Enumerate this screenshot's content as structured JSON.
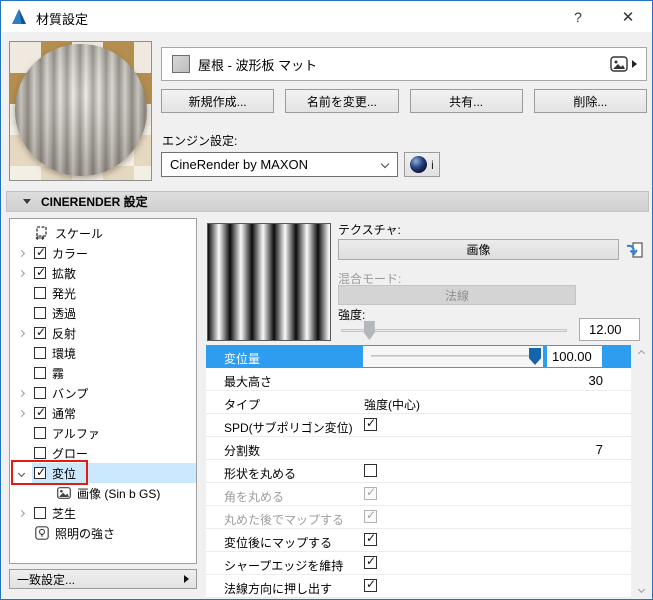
{
  "title_bar": {
    "title": "材質設定",
    "help_label": "?",
    "close_label": "✕"
  },
  "material_header": {
    "name": "屋根 - 波形板 マット"
  },
  "action_buttons": [
    {
      "label": "新規作成..."
    },
    {
      "label": "名前を変更..."
    },
    {
      "label": "共有..."
    },
    {
      "label": "削除..."
    }
  ],
  "engine": {
    "label": "エンジン設定:",
    "selected": "CineRender by MAXON",
    "info_label": "i"
  },
  "section_header": {
    "title": "CINERENDER 設定"
  },
  "channel_tree": {
    "items": [
      {
        "label": "スケール",
        "icon": "scale-icon"
      },
      {
        "label": "カラー",
        "expand": "collapsed",
        "checked": true
      },
      {
        "label": "拡散",
        "expand": "collapsed",
        "checked": true
      },
      {
        "label": "発光",
        "checked": false
      },
      {
        "label": "透過",
        "checked": false
      },
      {
        "label": "反射",
        "expand": "collapsed",
        "checked": true
      },
      {
        "label": "環境",
        "checked": false
      },
      {
        "label": "霧",
        "checked": false
      },
      {
        "label": "バンプ",
        "expand": "collapsed",
        "checked": false
      },
      {
        "label": "通常",
        "expand": "collapsed",
        "checked": true
      },
      {
        "label": "アルファ",
        "checked": false
      },
      {
        "label": "グロー",
        "checked": false
      },
      {
        "label": "変位",
        "expand": "expanded",
        "checked": true,
        "selected": true,
        "annotated": true
      },
      {
        "label": "画像 (Sin b GS)",
        "icon": "image-icon",
        "child": true
      },
      {
        "label": "芝生",
        "expand": "collapsed",
        "checked": false
      },
      {
        "label": "照明の強さ",
        "icon": "light-icon"
      }
    ]
  },
  "match_settings_button": {
    "label": "一致設定..."
  },
  "displacement_panel": {
    "texture_label": "テクスチャ:",
    "texture_button": "画像",
    "blend_mode_label": "混合モード:",
    "blend_mode_value": "法線",
    "strength_label": "強度:",
    "strength_value": "12.00",
    "strength_percent": 12,
    "rows": [
      {
        "label": "変位量",
        "control": "slider",
        "value": "100.00",
        "percent": 100,
        "selected": true
      },
      {
        "label": "最大高さ",
        "control": "number",
        "value": "30"
      },
      {
        "label": "タイプ",
        "control": "text",
        "value": "強度(中心)"
      },
      {
        "label": "SPD(サブポリゴン変位)",
        "control": "checkbox",
        "checked": true
      },
      {
        "label": "分割数",
        "control": "number",
        "value": "7"
      },
      {
        "label": "形状を丸める",
        "control": "checkbox",
        "checked": false
      },
      {
        "label": "角を丸める",
        "control": "checkbox",
        "checked": true,
        "disabled": true
      },
      {
        "label": "丸めた後でマップする",
        "control": "checkbox",
        "checked": true,
        "disabled": true
      },
      {
        "label": "変位後にマップする",
        "control": "checkbox",
        "checked": true
      },
      {
        "label": "シャープエッジを維持",
        "control": "checkbox",
        "checked": true
      },
      {
        "label": "法線方向に押し出す",
        "control": "checkbox",
        "checked": true
      }
    ]
  },
  "colors": {
    "selection_blue": "#2e9cef",
    "selection_light": "#cce8ff",
    "annotation_red": "#e11d12",
    "window_border": "#2374bd"
  }
}
